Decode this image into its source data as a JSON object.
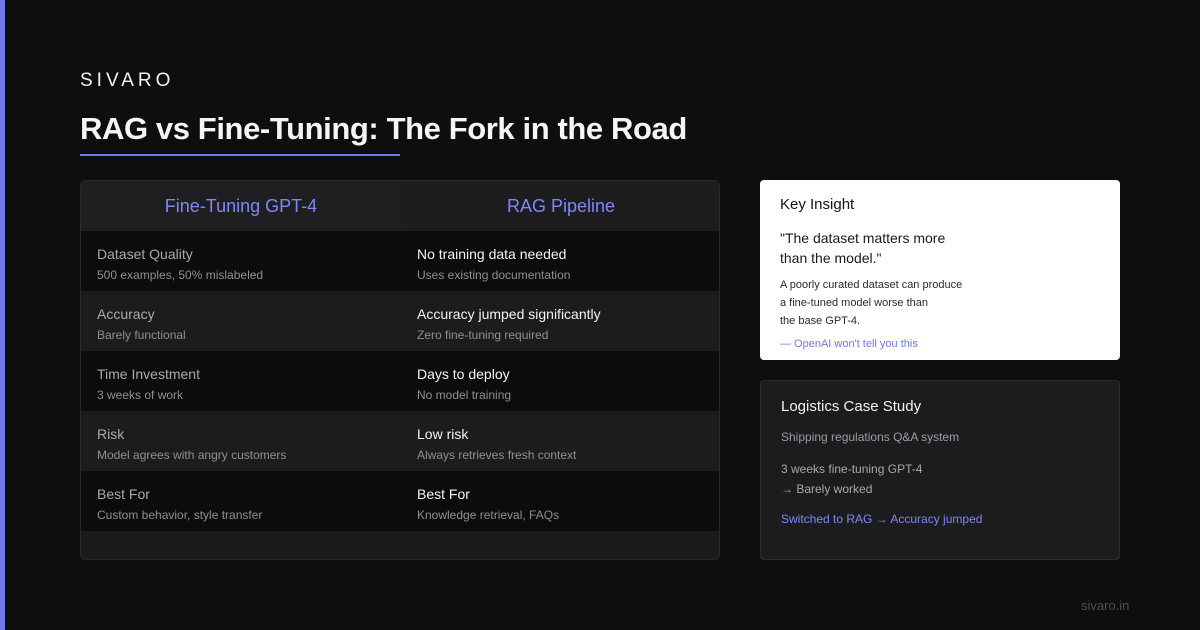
{
  "brand": "SIVARO",
  "title": "RAG vs Fine-Tuning: The Fork in the Road",
  "colors": {
    "accent": "#7278ee",
    "background": "#0e0e0f",
    "card_light": "#ffffff",
    "card_dark": "#1c1c1f"
  },
  "comparison": {
    "headers": [
      "Fine-Tuning GPT-4",
      "RAG Pipeline"
    ],
    "rows": [
      {
        "left": {
          "title": "Dataset Quality",
          "sub": "500 examples, 50% mislabeled"
        },
        "right": {
          "title": "No training data needed",
          "sub": "Uses existing documentation"
        }
      },
      {
        "left": {
          "title": "Accuracy",
          "sub": "Barely functional"
        },
        "right": {
          "title": "Accuracy jumped significantly",
          "sub": "Zero fine-tuning required"
        }
      },
      {
        "left": {
          "title": "Time Investment",
          "sub": "3 weeks of work"
        },
        "right": {
          "title": "Days to deploy",
          "sub": "No model training"
        }
      },
      {
        "left": {
          "title": "Risk",
          "sub": "Model agrees with angry customers"
        },
        "right": {
          "title": "Low risk",
          "sub": "Always retrieves fresh context"
        }
      },
      {
        "left": {
          "title": "Best For",
          "sub": "Custom behavior, style transfer"
        },
        "right": {
          "title": "Best For",
          "sub": "Knowledge retrieval, FAQs"
        }
      }
    ]
  },
  "insight": {
    "heading": "Key Insight",
    "quote_line1": "\"The dataset matters more",
    "quote_line2": "than the model.\"",
    "body_line1": "A poorly curated dataset can produce",
    "body_line2": "a fine-tuned model worse than",
    "body_line3": "the base GPT-4.",
    "attribution": "— OpenAI won't tell you this"
  },
  "case_study": {
    "heading": "Logistics Case Study",
    "subtitle": "Shipping regulations Q&A system",
    "line1": "3 weeks fine-tuning GPT-4",
    "line2": "→ Barely worked",
    "result": "Switched to RAG → Accuracy jumped"
  },
  "footer": "sivaro.in"
}
